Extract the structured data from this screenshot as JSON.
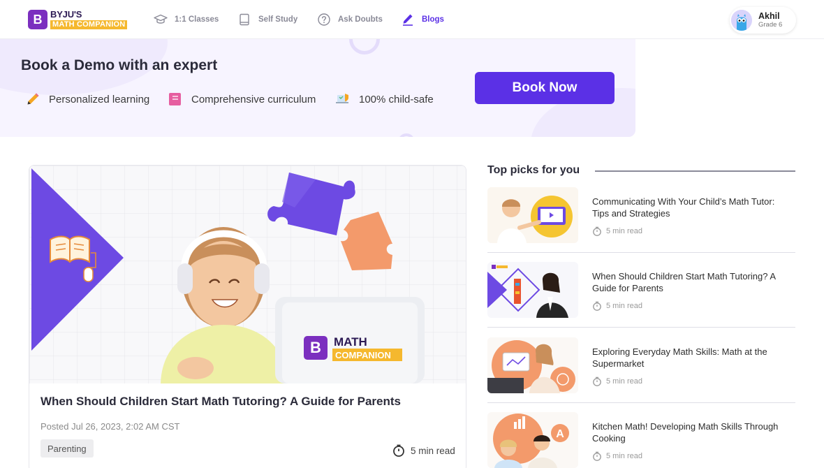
{
  "brand": {
    "top": "BYJU'S",
    "bottom": "MATH COMPANION",
    "initial": "B"
  },
  "nav": {
    "items": [
      {
        "label": "1:1 Classes",
        "icon": "graduation-cap-icon"
      },
      {
        "label": "Self Study",
        "icon": "book-icon"
      },
      {
        "label": "Ask Doubts",
        "icon": "question-bubble-icon"
      },
      {
        "label": "Blogs",
        "icon": "pencil-icon",
        "active": true
      }
    ]
  },
  "profile": {
    "name": "Akhil",
    "grade": "Grade 6"
  },
  "banner": {
    "title": "Book a Demo with an expert",
    "features": [
      "Personalized learning",
      "Comprehensive curriculum",
      "100% child-safe"
    ],
    "button": "Book Now"
  },
  "featured": {
    "title": "When Should Children Start Math Tutoring? A Guide for Parents",
    "posted": "Posted Jul 26, 2023, 2:02 AM CST",
    "tag": "Parenting",
    "read_time": "5 min read",
    "hero_logo": {
      "line1": "MATH",
      "line2": "COMPANION",
      "initial": "B"
    }
  },
  "top_picks": {
    "title": "Top picks for you",
    "items": [
      {
        "title": "Communicating With Your Child’s Math Tutor: Tips and Strategies",
        "read_time": "5 min read"
      },
      {
        "title": "When Should Children Start Math Tutoring? A Guide for Parents",
        "read_time": "5 min read"
      },
      {
        "title": "Exploring Everyday Math Skills: Math at the Supermarket",
        "read_time": "5 min read"
      },
      {
        "title": "Kitchen Math! Developing Math Skills Through Cooking",
        "read_time": "5 min read"
      }
    ]
  },
  "colors": {
    "accent": "#5b30e6",
    "brand_purple": "#7b2fbf",
    "brand_yellow": "#f5b82e",
    "banner_bg": "#f7f4ff"
  }
}
